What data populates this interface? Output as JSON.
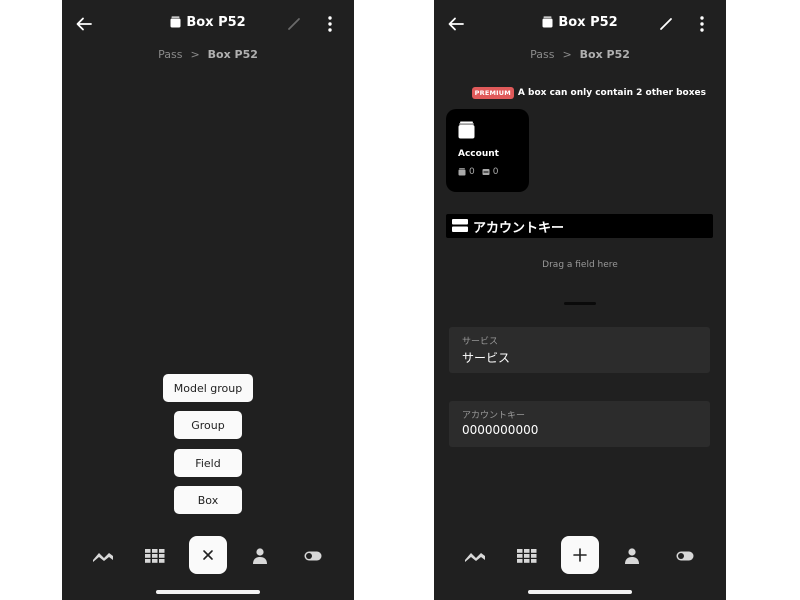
{
  "left": {
    "title": "Box P52",
    "breadcrumb": {
      "parent": "Pass",
      "separator": ">",
      "current": "Box P52"
    },
    "add_menu": [
      "Model group",
      "Group",
      "Field",
      "Box"
    ],
    "fab_icon": "close-icon"
  },
  "right": {
    "title": "Box P52",
    "breadcrumb": {
      "parent": "Pass",
      "separator": ">",
      "current": "Box P52"
    },
    "premium": {
      "badge": "PREMIUM",
      "message": "A box can only contain 2 other boxes"
    },
    "box_card": {
      "name": "Account",
      "box_count": "0",
      "field_count": "0"
    },
    "group": {
      "title": "アカウントキー"
    },
    "drag_hint": "Drag a field here",
    "fields": [
      {
        "label": "サービス",
        "value": "サービス"
      },
      {
        "label": "アカウントキー",
        "value": "0000000000"
      }
    ],
    "fab_icon": "plus-icon"
  },
  "bottom_nav_icons": [
    "activity-icon",
    "grid-icon",
    "fab",
    "person-icon",
    "toggle-icon"
  ],
  "colors": {
    "background": "#202020",
    "card": "#000000",
    "field": "#2c2c2c",
    "premium": "#e05a5a",
    "button": "#fafafa"
  }
}
